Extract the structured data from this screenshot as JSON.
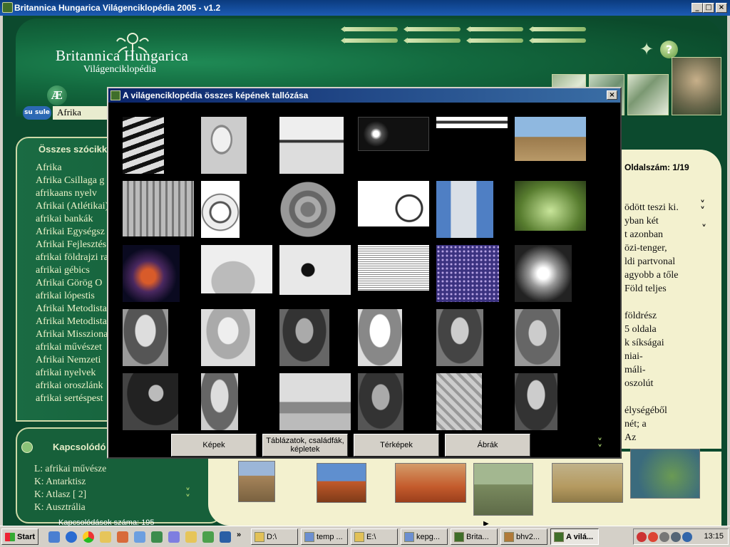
{
  "window": {
    "title": "Britannica Hungarica Világenciklopédia 2005 - v1.2",
    "minimize": "_",
    "maximize": "□",
    "close": "×"
  },
  "header": {
    "brand": "Britannica Hungarica",
    "subtitle": "Világenciklopédia",
    "help": "?",
    "compass": "✦",
    "ae": "Æ",
    "su_badge": "su sule"
  },
  "search": {
    "value": "Afrika"
  },
  "left_panel": {
    "title": "Összes szócikk",
    "items": [
      "Afrika",
      "Afrika Csillaga g",
      "afrikaans nyelv",
      "Afrikai (Atlétikai)",
      "afrikai bankák",
      "Afrikai Egységsz",
      "Afrikai Fejlesztés",
      "afrikai földrajzi ra",
      "afrikai gébics",
      "Afrikai Görög O",
      "afrikai lópestis",
      "Afrikai Metodista",
      "Afrikai Metodista",
      "Afrikai Missziona",
      "afrikai művészet",
      "Afrikai Nemzeti",
      "afrikai nyelvek",
      "afrikai oroszlánk",
      "afrikai sertéspest"
    ]
  },
  "related": {
    "title": "Kapcsolódó s",
    "items": [
      "L: afrikai művésze",
      "K: Antarktisz",
      "K: Atlasz [ 2]",
      "K: Ausztrália"
    ],
    "count_label": "Kapcsolódások száma:",
    "count": "195"
  },
  "article": {
    "page_label": "Oldalszám: 1/19",
    "lines": [
      "ödött teszi ki.",
      "yban két",
      "t azonban",
      "özi-tenger,",
      "ldi partvonal",
      "agyobb a tőle",
      "Föld teljes",
      "",
      "földrész",
      "5 oldala",
      "k síkságai",
      "niai-",
      "máli-",
      "oszolút",
      "",
      "élységéből",
      "nét; a",
      "Az"
    ]
  },
  "dialog": {
    "title": "A világenciklopédia összes képének tallózása",
    "close": "×",
    "buttons": [
      "Képek",
      "Táblázatok, családfák, képletek",
      "Térképek",
      "Ábrák"
    ],
    "thumbs": [
      "runners-photo",
      "radio-telescope-photo",
      "hurdlers-photo",
      "twin-stars-photo",
      "rifle-photo",
      "plaza-tower-photo",
      "colonnade-building-photo",
      "astrolabe-photo",
      "aztec-calendar-stone-photo",
      "rickshaw-photo",
      "highrise-photo",
      "subway-station-photo",
      "nebula-photo",
      "stupa-photo",
      "ink-painting-photo",
      "open-book-photo",
      "star-field-photo",
      "globular-cluster-photo",
      "portrait-man-1",
      "portrait-man-2",
      "portrait-bearded-man",
      "portrait-man-3",
      "portrait-man-4",
      "portrait-abauzit",
      "men-at-desk-photo",
      "portrait-man-cap",
      "mosque-photo",
      "portrait-man-turban",
      "relief-carving-photo",
      "portrait-man-5"
    ]
  },
  "taskbar": {
    "start": "Start",
    "more": "»",
    "tasks": [
      "D:\\",
      "temp ...",
      "E:\\",
      "kepg...",
      "Brita...",
      "bhv2...",
      "A vilá..."
    ],
    "clock": "13:15"
  }
}
